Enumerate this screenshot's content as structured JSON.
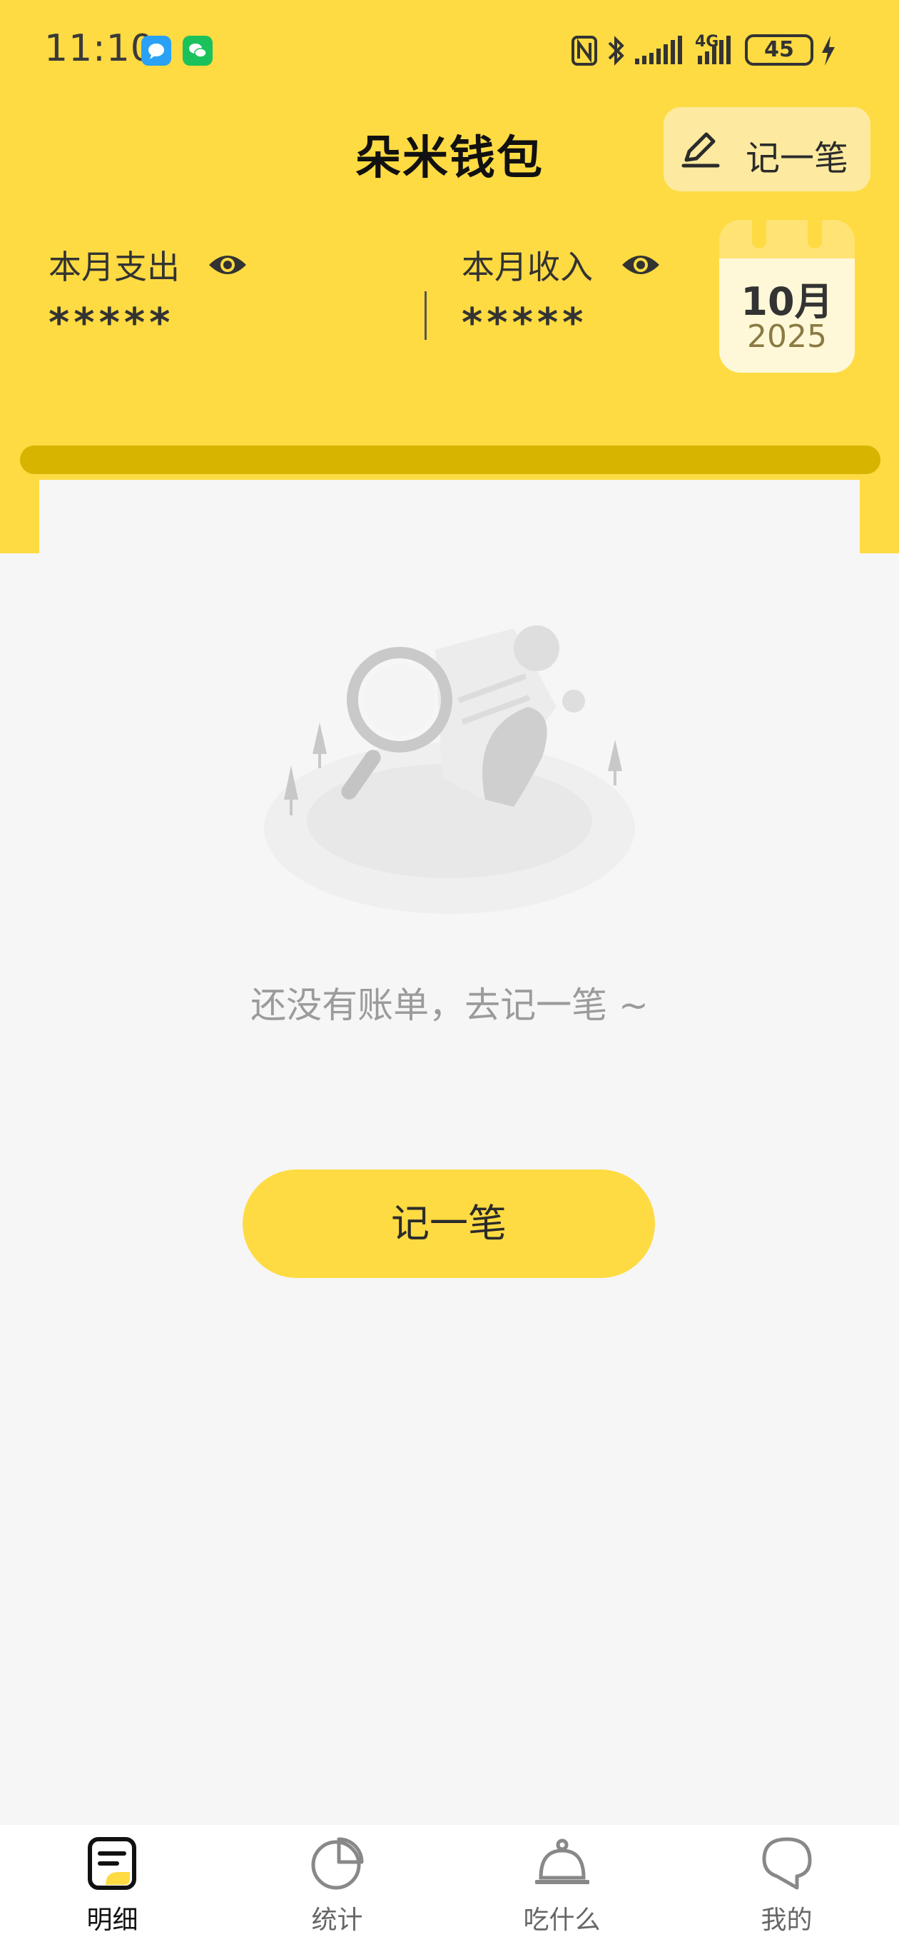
{
  "status_bar": {
    "time": "11:10",
    "network": "4G",
    "battery": "45"
  },
  "header": {
    "title": "朵米钱包",
    "record_button": "记一笔"
  },
  "summary": {
    "expense_label": "本月支出",
    "expense_value": "*****",
    "income_label": "本月收入",
    "income_value": "*****"
  },
  "calendar": {
    "month": "10月",
    "year": "2025"
  },
  "empty_state": {
    "message": "还没有账单，去记一笔 ~",
    "button": "记一笔"
  },
  "nav": [
    {
      "label": "明细",
      "icon": "bill-detail-icon",
      "active": true
    },
    {
      "label": "统计",
      "icon": "pie-chart-icon",
      "active": false
    },
    {
      "label": "吃什么",
      "icon": "food-cloche-icon",
      "active": false
    },
    {
      "label": "我的",
      "icon": "profile-icon",
      "active": false
    }
  ],
  "colors": {
    "accent": "#fedb42",
    "background": "#f6f6f7"
  }
}
